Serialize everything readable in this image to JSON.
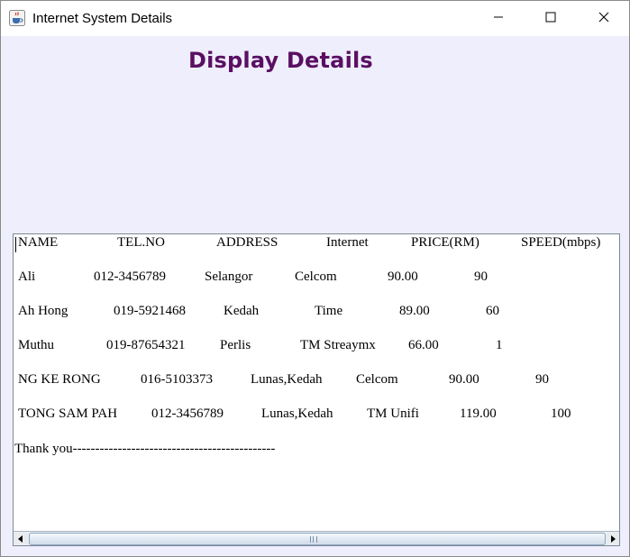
{
  "window": {
    "title": "Internet System Details",
    "icon": "java-coffee-cup-icon"
  },
  "controls": {
    "minimize": "minimize-icon",
    "maximize": "maximize-icon",
    "close": "close-icon"
  },
  "heading": "Display Details",
  "table": {
    "headers": [
      "NAME",
      "TEL.NO",
      "ADDRESS",
      "Internet",
      "PRICE(RM)",
      "SPEED(mbps)"
    ],
    "rows": [
      [
        "Ali",
        "012-3456789",
        "Selangor",
        "Celcom",
        "90.00",
        "90"
      ],
      [
        "Ah Hong",
        "019-5921468",
        "Kedah",
        "Time",
        "89.00",
        "60"
      ],
      [
        "Muthu",
        "019-87654321",
        "Perlis",
        "TM Streaymx",
        "66.00",
        "1"
      ],
      [
        "NG KE RONG",
        "016-5103373",
        "Lunas,Kedah",
        "Celcom",
        "90.00",
        "90"
      ],
      [
        "TONG SAM PAH",
        "012-3456789",
        "Lunas,Kedah",
        "TM Unifi",
        "119.00",
        "100"
      ]
    ]
  },
  "footer_text": "Thank you---------------------------------------------",
  "colors": {
    "heading": "#5a0f63",
    "window_bg": "#eeeefc"
  }
}
